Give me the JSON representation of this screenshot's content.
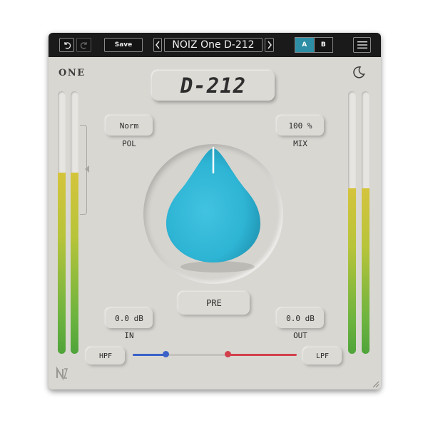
{
  "topbar": {
    "save_label": "Save",
    "preset_name": "NOIZ One D-212",
    "ab_a": "A",
    "ab_b": "B"
  },
  "brand": {
    "one_logo": "ONE",
    "title": "D-212"
  },
  "controls": {
    "pol_value": "Norm",
    "pol_label": "POL",
    "mix_value": "100 %",
    "mix_label": "MIX",
    "pre_label": "PRE",
    "in_value": "0.0 dB",
    "in_label": "IN",
    "out_value": "0.0 dB",
    "out_label": "OUT",
    "hpf_label": "HPF",
    "lpf_label": "LPF"
  },
  "meters": {
    "input_left_level": 0.69,
    "input_right_level": 0.69,
    "output_left_level": 0.63,
    "output_right_level": 0.63
  },
  "filters": {
    "hpf_position": 0.2,
    "lpf_position": 0.58
  },
  "colors": {
    "panel": "#d9d7d2",
    "topbar": "#1a1a1a",
    "accent": "#2d8ea5",
    "knob": "#2eb4d4",
    "hpf_track": "#3a62c8",
    "lpf_track": "#d2404c"
  }
}
